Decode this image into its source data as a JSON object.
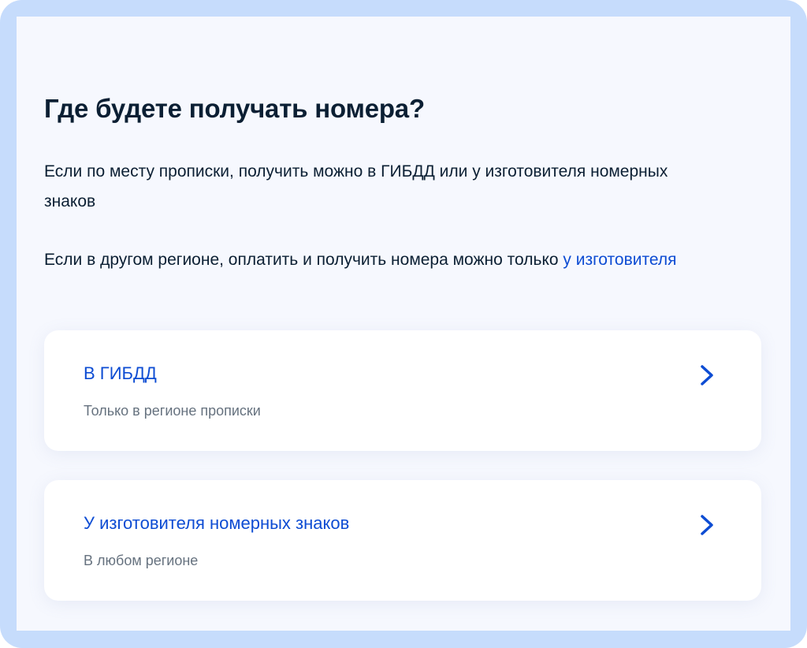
{
  "page": {
    "title": "Где будете получать номера?",
    "paragraph1": "Если по месту прописки, получить можно в ГИБДД или у изготовителя номерных знаков",
    "paragraph2_text": "Если в другом регионе, оплатить и получить номера можно только ",
    "paragraph2_link": "у изготовителя"
  },
  "options": [
    {
      "title": "В ГИБДД",
      "subtitle": "Только в регионе прописки",
      "icon": "chevron-right-icon"
    },
    {
      "title": "У изготовителя номерных знаков",
      "subtitle": "В любом регионе",
      "icon": "chevron-right-icon"
    }
  ],
  "colors": {
    "frame": "#c6dcfc",
    "background": "#f6f8fe",
    "text": "#0b1f33",
    "link": "#0d4cd3",
    "muted": "#66727f"
  }
}
